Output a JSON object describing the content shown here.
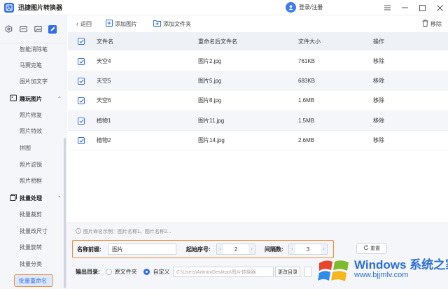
{
  "app": {
    "title": "迅捷图片转换器",
    "login_label": "登录/注册",
    "accent": "#2f6cf0",
    "highlight": "#f28b3a"
  },
  "window_controls": [
    "menu-icon",
    "minimize-icon",
    "maximize-icon",
    "close-icon"
  ],
  "sidebar": {
    "top_icons": [
      "settings-hex-icon",
      "image-card-icon",
      "photo-icon",
      "edit-icon"
    ],
    "items_top": [
      {
        "label": "智能消除笔"
      },
      {
        "label": "马赛克笔"
      },
      {
        "label": "图片加文字"
      }
    ],
    "group_fun": {
      "label": "趣玩图片",
      "icon": "fun-image-icon"
    },
    "items_fun": [
      {
        "label": "照片修复"
      },
      {
        "label": "照片特效"
      },
      {
        "label": "拼图"
      },
      {
        "label": "照片滤镜"
      },
      {
        "label": "照片相框"
      }
    ],
    "group_batch": {
      "label": "批量处理",
      "icon": "batch-icon"
    },
    "items_batch": [
      {
        "label": "批量裁剪"
      },
      {
        "label": "批量改尺寸"
      },
      {
        "label": "批量旋转"
      },
      {
        "label": "批量分类"
      }
    ],
    "active_item": {
      "label": "批量重命名"
    }
  },
  "toolbar": {
    "back_label": "返回",
    "add_image_label": "添加图片",
    "add_folder_label": "添加文件夹",
    "remove_label": "移除"
  },
  "table": {
    "headers": {
      "name": "文件名",
      "new_name": "重命名后文件名",
      "size": "文件大小",
      "action": "操作"
    },
    "rows": [
      {
        "name": "天空4",
        "new_name": "图片2.jpg",
        "size": "761KB",
        "action": "移除",
        "checked": true
      },
      {
        "name": "天空5",
        "new_name": "图片5.jpg",
        "size": "683KB",
        "action": "移除",
        "checked": true
      },
      {
        "name": "天空6",
        "new_name": "图片8.jpg",
        "size": "1.6MB",
        "action": "移除",
        "checked": true
      },
      {
        "name": "植物1",
        "new_name": "图片11.jpg",
        "size": "1.5MB",
        "action": "移除",
        "checked": true
      },
      {
        "name": "植物2",
        "new_name": "图片14.jpg",
        "size": "2.6MB",
        "action": "移除",
        "checked": true
      }
    ]
  },
  "rename": {
    "hint": "图片命名示例：图片名称1、图片名称2...",
    "prefix_label": "名称前缀:",
    "prefix_value": "图片",
    "start_label": "起始序号:",
    "start_value": "2",
    "interval_label": "间隔数:",
    "interval_value": "3",
    "reset_label": "重置"
  },
  "output": {
    "label": "输出目录:",
    "option_original": "原文件夹",
    "option_custom": "自定义",
    "selected": "自定义",
    "path": "C:\\Users\\Admin\\Desktop\\图片转换器",
    "change_label": "更改目录"
  },
  "watermark": {
    "brand": "Windows 系统之家",
    "url": "www.bjjmlv.com"
  }
}
